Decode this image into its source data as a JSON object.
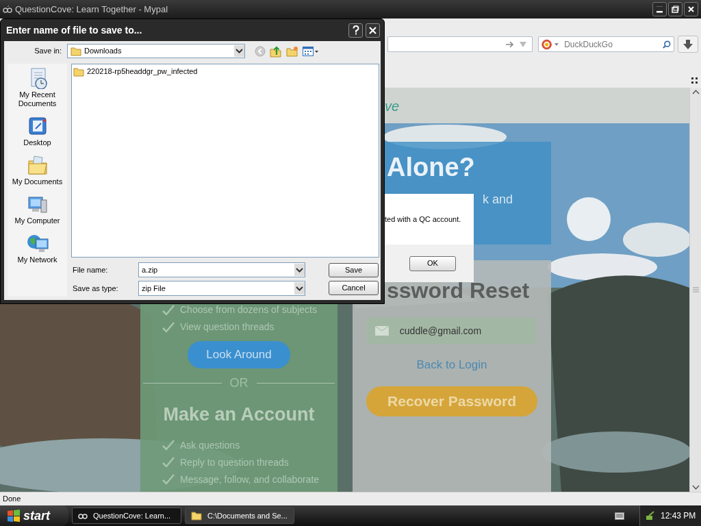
{
  "browser": {
    "title": "QuestionCove: Learn Together - Mypal",
    "search": {
      "placeholder": "DuckDuckGo"
    },
    "status_bar": "Done"
  },
  "page": {
    "logo_fragment": "ve",
    "hero_heading": "Alone?",
    "hero_text": "k and",
    "left_panel": {
      "features_top": [
        "Choose from dozens of subjects",
        "View question threads"
      ],
      "button": "Look Around",
      "divider": "OR",
      "heading": "Make an Account",
      "features": [
        "Ask questions",
        "Reply to question threads",
        "Message, follow, and collaborate"
      ]
    },
    "reset_panel": {
      "heading": "ssword Reset",
      "email": "cuddle@gmail.com",
      "link": "Back to Login",
      "button": "Recover Password"
    }
  },
  "alert": {
    "message": "ted with a QC account.",
    "button": "OK"
  },
  "save_dialog": {
    "title": "Enter name of file to save to...",
    "save_in_label": "Save in:",
    "save_in": "Downloads",
    "places": [
      {
        "kind": "recent",
        "label": "My Recent Documents"
      },
      {
        "kind": "desktop",
        "label": "Desktop"
      },
      {
        "kind": "documents",
        "label": "My Documents"
      },
      {
        "kind": "computer",
        "label": "My Computer"
      },
      {
        "kind": "network",
        "label": "My Network"
      }
    ],
    "files": [
      {
        "name": "220218-rp5headdgr_pw_infected"
      }
    ],
    "file_name_label": "File name:",
    "file_name": "a.zip",
    "type_label": "Save as type:",
    "type": "zip File",
    "buttons": [
      "Save",
      "Cancel"
    ]
  },
  "taskbar": {
    "start": "start",
    "tasks": [
      {
        "label": "QuestionCove: Learn...",
        "kind": "browser",
        "selected": true
      },
      {
        "label": "C:\\Documents and Se...",
        "kind": "folder",
        "selected": false
      }
    ],
    "clock": "12:43 PM"
  }
}
